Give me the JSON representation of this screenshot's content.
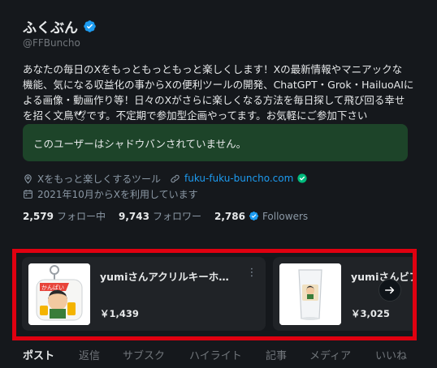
{
  "profile": {
    "display_name": "ふくぶん",
    "handle": "@FFBuncho",
    "bio_lines": [
      "あなたの毎日のXをもっともっともっと楽しくします！Xの最新情報やマニアックな",
      "機能、気になる収益化の事からXの便利ツールの開発、ChatGPT・Grok・HailuoAIに",
      "よる画像・動画作り等！日々のXがさらに楽しくなる方法を毎日探して飛び回る幸せ",
      "を招く文鳥🕊です。不定期で参加型企画やってます。お気軽にご参加下さい"
    ],
    "notice": "このユーザーはシャドウバンされていません。",
    "category": "Xをもっと楽しくするツール",
    "website": "fuku-fuku-buncho.com",
    "joined": "2021年10月からXを利用しています",
    "following_count": "2,579",
    "following_label": "フォロー中",
    "followers_count": "9,743",
    "followers_label": "フォロワー",
    "verified_followers_count": "2,786",
    "verified_followers_label": "Followers"
  },
  "shop": {
    "items": [
      {
        "title": "yumiさんアクリルキーホ…",
        "price": "￥1,439",
        "menu": "⋮"
      },
      {
        "title": "yumiさんビア",
        "price": "￥3,025"
      }
    ]
  },
  "tabs": [
    "ポスト",
    "返信",
    "サブスク",
    "ハイライト",
    "記事",
    "メディア",
    "いいね"
  ],
  "colors": {
    "background": "#15181c",
    "accent": "#1d9bf0",
    "notice_bg": "#1d4429",
    "highlight_border": "#e00010"
  }
}
